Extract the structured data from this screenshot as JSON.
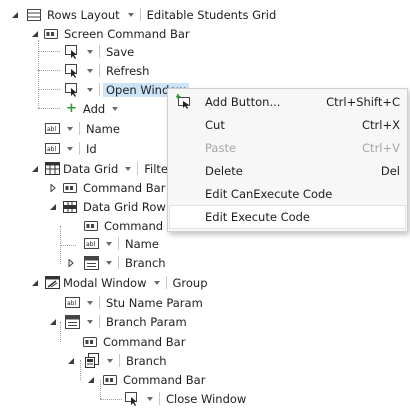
{
  "tree": {
    "root": {
      "label": "Rows Layout",
      "title": "Editable Students Grid",
      "icon": "rows-layout-icon"
    },
    "screen_command_bar": {
      "label": "Screen Command Bar",
      "icon": "command-bar-icon"
    },
    "save": {
      "label": "Save",
      "icon": "button-icon"
    },
    "refresh": {
      "label": "Refresh",
      "icon": "button-icon"
    },
    "open_window": {
      "label": "Open Window",
      "icon": "button-icon"
    },
    "add": {
      "label": "Add",
      "icon": "add-icon"
    },
    "name": {
      "label": "Name",
      "icon": "textbox-icon"
    },
    "id": {
      "label": "Id",
      "icon": "textbox-icon"
    },
    "data_grid": {
      "label": "Data Grid",
      "filter": "Filter",
      "icon": "data-grid-icon"
    },
    "dg_command_bar": {
      "label": "Command Bar",
      "icon": "command-bar-icon"
    },
    "data_grid_row": {
      "label": "Data Grid Row",
      "icon": "data-grid-row-icon"
    },
    "dgr_command_bar": {
      "label": "Command Ba",
      "icon": "command-bar-icon"
    },
    "dgr_name": {
      "label": "Name",
      "icon": "textbox-icon"
    },
    "dgr_branch": {
      "label": "Branch",
      "icon": "picker-icon"
    },
    "modal_window": {
      "label": "Modal Window",
      "group": "Group",
      "icon": "modal-window-icon"
    },
    "stu_name_param": {
      "label": "Stu Name Param",
      "icon": "textbox-icon"
    },
    "branch_param": {
      "label": "Branch Param",
      "icon": "picker-icon"
    },
    "bp_command_bar": {
      "label": "Command Bar",
      "icon": "command-bar-icon"
    },
    "branch": {
      "label": "Branch",
      "icon": "details-icon"
    },
    "b_command_bar": {
      "label": "Command Bar",
      "icon": "command-bar-icon"
    },
    "close_window": {
      "label": "Close Window",
      "icon": "button-icon"
    }
  },
  "context_menu": {
    "items": [
      {
        "label": "Add Button...",
        "shortcut": "Ctrl+Shift+C",
        "icon": "add-button-icon",
        "enabled": true
      },
      {
        "label": "Cut",
        "shortcut": "Ctrl+X",
        "enabled": true
      },
      {
        "label": "Paste",
        "shortcut": "Ctrl+V",
        "enabled": false
      },
      {
        "label": "Delete",
        "shortcut": "Del",
        "enabled": true
      },
      {
        "label": "Edit CanExecute Code",
        "shortcut": "",
        "enabled": true
      },
      {
        "label": "Edit Execute Code",
        "shortcut": "",
        "enabled": true,
        "highlighted": true
      }
    ]
  },
  "colors": {
    "selection": "#cce4f7",
    "menu_bg": "#f7f7f7",
    "add_plus": "#2f9a2f",
    "disabled_text": "#a6a6a6"
  }
}
